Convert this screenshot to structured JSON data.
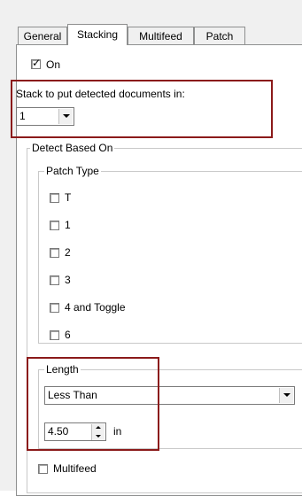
{
  "tabs": [
    "General",
    "Stacking",
    "Multifeed",
    "Patch"
  ],
  "on": {
    "label": "On",
    "checked": true
  },
  "stack": {
    "label": "Stack to put detected documents in:",
    "value": "1"
  },
  "detect_group": {
    "title": "Detect Based On"
  },
  "patch_type": {
    "title": "Patch Type",
    "items": [
      "T",
      "1",
      "2",
      "3",
      "4 and Toggle",
      "6"
    ]
  },
  "length": {
    "title": "Length",
    "mode": "Less Than",
    "value": "4.50",
    "unit": "in"
  },
  "multifeed": {
    "label": "Multifeed",
    "checked": false
  },
  "colors": {
    "highlight": "#8b1a1a",
    "panel": "#ffffff",
    "dialog_bg": "#f0f0f0"
  }
}
